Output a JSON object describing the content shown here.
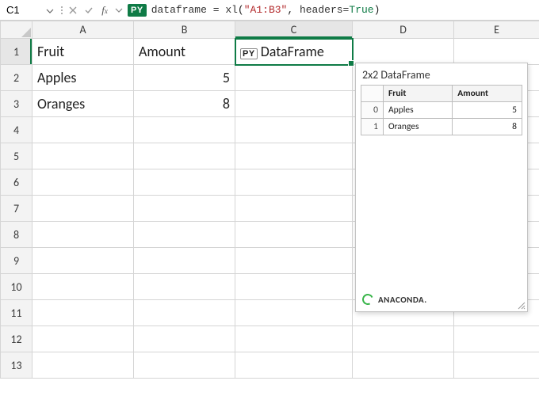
{
  "formula_bar": {
    "name_box_value": "C1",
    "py_badge": "PY",
    "formula_var": "dataframe",
    "formula_eq": " = ",
    "formula_fn": "xl",
    "formula_open": "(",
    "formula_str": "\"A1:B3\"",
    "formula_comma": ", ",
    "formula_param": "headers=",
    "formula_bool": "True",
    "formula_close": ")"
  },
  "columns": [
    "A",
    "B",
    "C",
    "D",
    "E"
  ],
  "rows": [
    "1",
    "2",
    "3",
    "4",
    "5",
    "6",
    "7",
    "8",
    "9",
    "10",
    "11",
    "12",
    "13"
  ],
  "selected": {
    "col": "C",
    "row": "1"
  },
  "cells": {
    "A1": "Fruit",
    "B1": "Amount",
    "C1_chip": "PY",
    "C1_label": "DataFrame",
    "A2": "Apples",
    "B2": "5",
    "A3": "Oranges",
    "B3": "8"
  },
  "preview": {
    "title": "2x2 DataFrame",
    "col1": "Fruit",
    "col2": "Amount",
    "rows": [
      {
        "idx": "0",
        "fruit": "Apples",
        "amount": "5"
      },
      {
        "idx": "1",
        "fruit": "Oranges",
        "amount": "8"
      }
    ],
    "footer": "ANACONDA."
  },
  "chart_data": {
    "type": "table",
    "title": "2x2 DataFrame",
    "columns": [
      "Fruit",
      "Amount"
    ],
    "index": [
      0,
      1
    ],
    "rows": [
      {
        "Fruit": "Apples",
        "Amount": 5
      },
      {
        "Fruit": "Oranges",
        "Amount": 8
      }
    ]
  }
}
